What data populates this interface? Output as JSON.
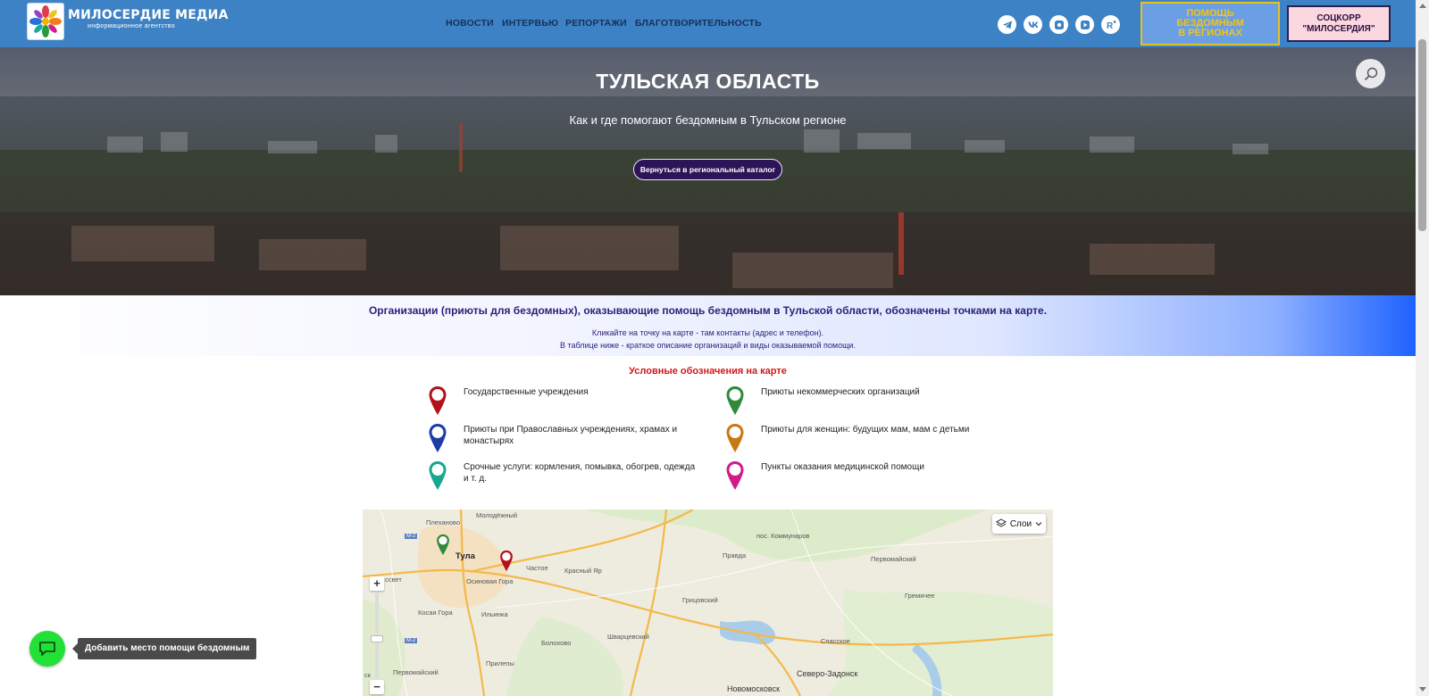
{
  "header": {
    "brand_name": "МИЛОСЕРДИЕ МЕДИА",
    "brand_tagline": "информационное агентство",
    "nav": [
      "НОВОСТИ",
      "ИНТЕРВЬЮ",
      "РЕПОРТАЖИ",
      "БЛАГОТВОРИТЕЛЬНОСТЬ"
    ],
    "social_icons": [
      "telegram-icon",
      "vk-icon",
      "odnoklassniki-icon",
      "dzen-icon",
      "rutube-icon"
    ],
    "help_button_lines": [
      "ПОМОЩЬ",
      "БЕЗДОМНЫМ",
      "В РЕГИОНАХ"
    ],
    "socs_button_lines": [
      "СОЦКОРР",
      "\"МИЛОСЕРДИЯ\""
    ],
    "colors": {
      "bar": "#3d82c4",
      "help_text": "#f2c418",
      "socs_bg": "#fbd7df"
    }
  },
  "hero": {
    "title": "ТУЛЬСКАЯ ОБЛАСТЬ",
    "subtitle": "Как и где помогают бездомным в Тульском регионе",
    "back_button": "Вернуться в региональный каталог",
    "search_icon": "search-icon"
  },
  "info": {
    "title": "Организации (приюты для бездомных), оказывающие помощь бездомным в Тульской области, обозначены точками на карте.",
    "line1": "Кликайте на точку на карте - там контакты (адрес и телефон).",
    "line2": "В таблице ниже - краткое описание организаций и виды оказываемой помощи."
  },
  "legend": {
    "title": "Условные обозначения на карте",
    "items": [
      {
        "label": "Государственные учреждения",
        "color": "#b3121c"
      },
      {
        "label": "Приюты некоммерческих организаций",
        "color": "#2f8a3a"
      },
      {
        "label": "Приюты при Православных учреждениях, храмах и монастырях",
        "color": "#1c3ca8"
      },
      {
        "label": "Приюты для женщин: будущих мам, мам с детьми",
        "color": "#c87914"
      },
      {
        "label": "Срочные услуги: кормления, помывка, обогрев, одежда и т. д.",
        "color": "#17a88d"
      },
      {
        "label": "Пункты оказания медицинской помощи",
        "color": "#d01c8b"
      }
    ]
  },
  "map": {
    "layers_label": "Слои",
    "zoom_in": "+",
    "zoom_out": "−",
    "places": [
      "Молодёжный",
      "Плеханово",
      "Тула",
      "Частое",
      "Осиновая Гора",
      "Красный Яр",
      "Правда",
      "пос. Коммунаров",
      "Первомайский",
      "Грицовский",
      "Гремячее",
      "Косая Гора",
      "Ильинка",
      "Болохово",
      "Шварцевский",
      "Спасское",
      "Первомайский",
      "Прилепы",
      "Северо-Задонск",
      "Новомосковск",
      "ссвет",
      "ск"
    ],
    "road_labels": [
      "M-2",
      "M-2"
    ]
  },
  "floating": {
    "add_place_tooltip": "Добавить место помощи бездомным",
    "chat_icon": "chat-icon"
  }
}
